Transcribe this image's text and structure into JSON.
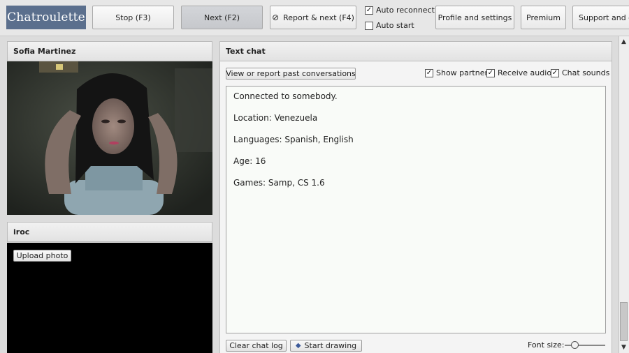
{
  "topbar": {
    "logo": "Chatroulette",
    "stop_label": "Stop (F3)",
    "next_label": "Next (F2)",
    "report_label": "Report & next (F4)",
    "report_icon": "prohibited-icon",
    "auto_reconnect": {
      "label": "Auto reconnect",
      "checked": true
    },
    "auto_start": {
      "label": "Auto start",
      "checked": false
    },
    "profile_label": "Profile and settings",
    "premium_label": "Premium",
    "support_label": "Support and co"
  },
  "partner": {
    "name": "Sofia Martinez"
  },
  "self": {
    "name": "iroc",
    "upload_label": "Upload photo"
  },
  "chat": {
    "title": "Text chat",
    "history_label": "View or report past conversations",
    "options": [
      {
        "label": "Show partner",
        "checked": true
      },
      {
        "label": "Receive audio",
        "checked": true
      },
      {
        "label": "Chat sounds",
        "checked": true
      }
    ],
    "messages": [
      "Connected to somebody.",
      "Location: Venezuela",
      "Languages: Spanish, English",
      "Age: 16",
      "Games: Samp, CS 1.6"
    ],
    "clear_label": "Clear chat log",
    "draw_label": "Start drawing",
    "draw_icon": "pencil-icon",
    "font_size_label": "Font size:"
  },
  "colors": {
    "logo_bg": "#5b6f8d",
    "page_bg": "#dcdcdc"
  }
}
